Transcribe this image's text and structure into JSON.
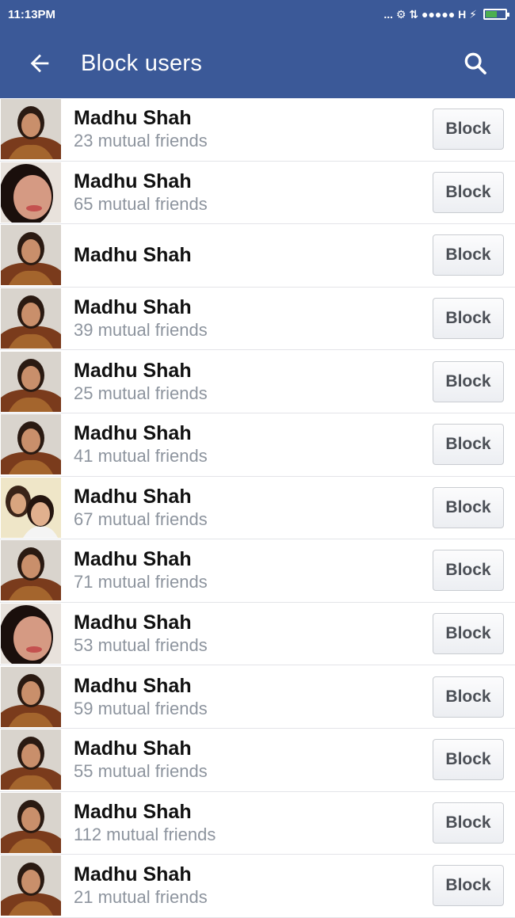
{
  "status_bar": {
    "time": "11:13PM",
    "icons_text": "... ⚙ ⇅ ●●●●● H ⚡"
  },
  "app_bar": {
    "title": "Block users",
    "back_icon": "arrow-left-icon",
    "search_icon": "search-icon"
  },
  "colors": {
    "brand": "#3b5998",
    "muted_text": "#8d949e"
  },
  "users": [
    {
      "name": "Madhu Shah",
      "mutual": "23 mutual friends",
      "button": "Block",
      "avatar": "a"
    },
    {
      "name": "Madhu Shah",
      "mutual": "65 mutual friends",
      "button": "Block",
      "avatar": "b"
    },
    {
      "name": "Madhu Shah",
      "mutual": "",
      "button": "Block",
      "avatar": "a"
    },
    {
      "name": "Madhu Shah",
      "mutual": "39 mutual friends",
      "button": "Block",
      "avatar": "a"
    },
    {
      "name": "Madhu Shah",
      "mutual": "25 mutual friends",
      "button": "Block",
      "avatar": "a"
    },
    {
      "name": "Madhu Shah",
      "mutual": "41 mutual friends",
      "button": "Block",
      "avatar": "a"
    },
    {
      "name": "Madhu Shah",
      "mutual": "67 mutual friends",
      "button": "Block",
      "avatar": "c"
    },
    {
      "name": "Madhu Shah",
      "mutual": "71 mutual friends",
      "button": "Block",
      "avatar": "a"
    },
    {
      "name": "Madhu Shah",
      "mutual": "53 mutual friends",
      "button": "Block",
      "avatar": "b"
    },
    {
      "name": "Madhu Shah",
      "mutual": "59 mutual friends",
      "button": "Block",
      "avatar": "a"
    },
    {
      "name": "Madhu Shah",
      "mutual": "55 mutual friends",
      "button": "Block",
      "avatar": "a"
    },
    {
      "name": "Madhu Shah",
      "mutual": "112 mutual friends",
      "button": "Block",
      "avatar": "a"
    },
    {
      "name": "Madhu Shah",
      "mutual": "21 mutual friends",
      "button": "Block",
      "avatar": "a"
    }
  ]
}
